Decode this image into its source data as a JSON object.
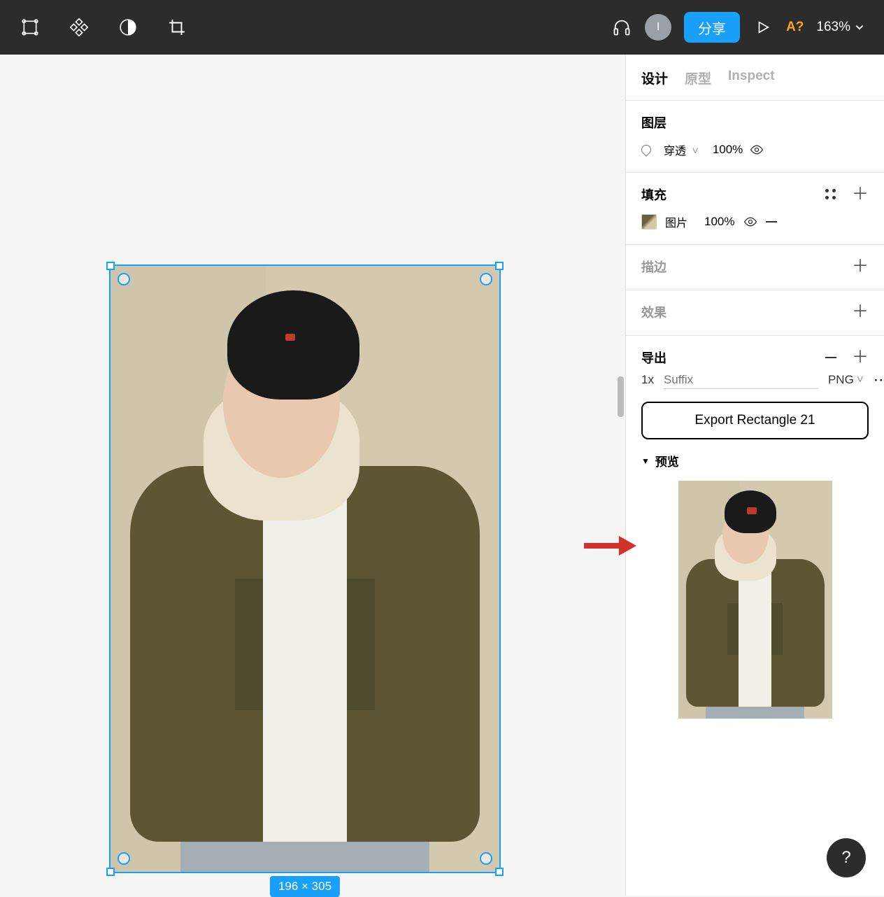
{
  "toolbar": {
    "avatar_initial": "I",
    "share_label": "分享",
    "zoom_label": "163%",
    "missing_font_label": "A?"
  },
  "canvas": {
    "selection_size_label": "196 × 305"
  },
  "panel": {
    "tabs": {
      "design": "设计",
      "prototype": "原型",
      "inspect": "Inspect"
    },
    "layer": {
      "title": "图层",
      "blend_mode": "穿透",
      "opacity": "100%"
    },
    "fill": {
      "title": "填充",
      "type_label": "图片",
      "opacity": "100%"
    },
    "stroke": {
      "title": "描边"
    },
    "effects": {
      "title": "效果"
    },
    "export": {
      "title": "导出",
      "scale": "1x",
      "suffix_placeholder": "Suffix",
      "format": "PNG",
      "button_label": "Export Rectangle 21",
      "preview_label": "预览"
    }
  },
  "help": {
    "label": "?"
  }
}
